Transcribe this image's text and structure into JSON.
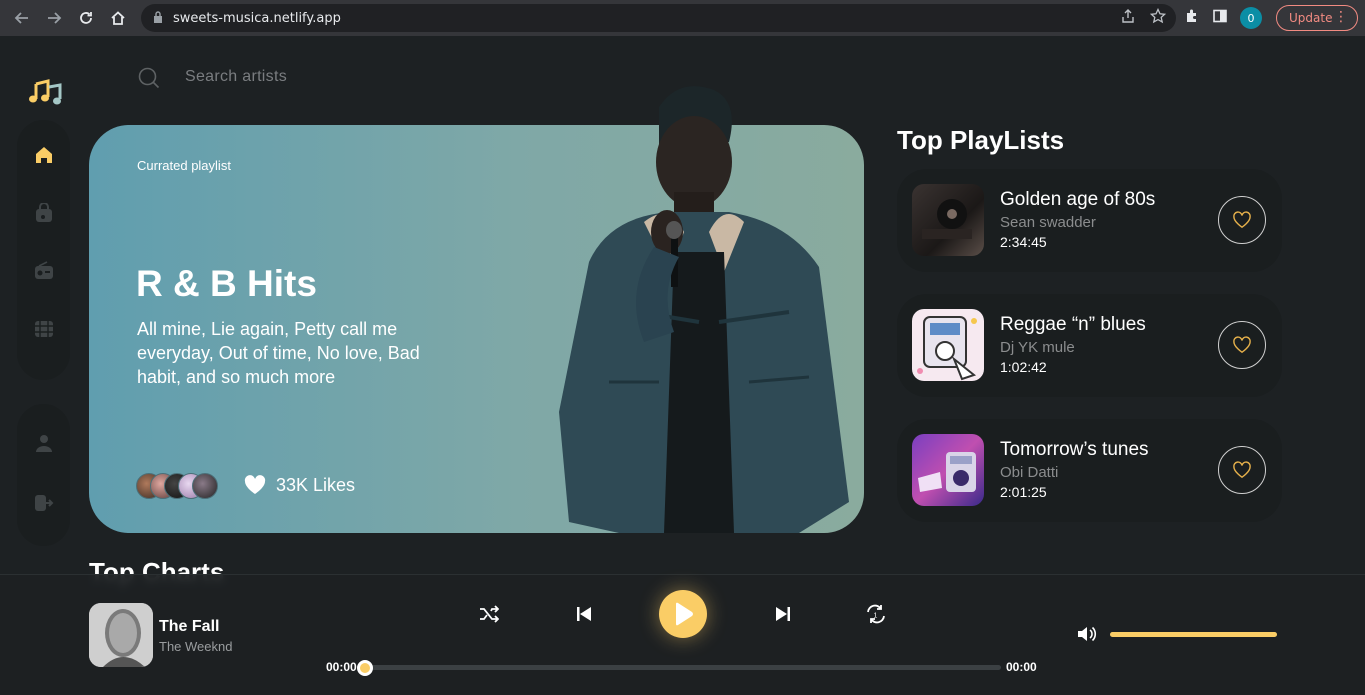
{
  "browser": {
    "url": "sweets-musica.netlify.app",
    "profile_initial": "0",
    "update_label": "Update"
  },
  "search": {
    "placeholder": "Search artists"
  },
  "hero": {
    "label": "Currated playlist",
    "title": "R & B Hits",
    "description": "All mine, Lie again, Petty call me everyday, Out of time, No love, Bad habit, and so much more",
    "likes": "33K Likes"
  },
  "playlists": {
    "title": "Top PlayLists",
    "items": [
      {
        "name": "Golden age of 80s",
        "artist": "Sean swadder",
        "duration": "2:34:45"
      },
      {
        "name": "Reggae “n” blues",
        "artist": "Dj YK mule",
        "duration": "1:02:42"
      },
      {
        "name": "Tomorrow’s tunes",
        "artist": "Obi Datti",
        "duration": "2:01:25"
      }
    ]
  },
  "charts": {
    "title": "Top Charts"
  },
  "player": {
    "title": "The Fall",
    "artist": "The Weeknd",
    "current_time": "00:00",
    "total_time": "00:00",
    "progress": 0,
    "volume": 1.0
  },
  "colors": {
    "accent": "#facd66",
    "background": "#1d2123",
    "card": "#1a1e1f"
  },
  "icons": {
    "logo": "music-notes-icon",
    "nav": [
      "home-icon",
      "radio-bag-icon",
      "radio-icon",
      "video-icon",
      "profile-icon",
      "logout-icon"
    ]
  }
}
